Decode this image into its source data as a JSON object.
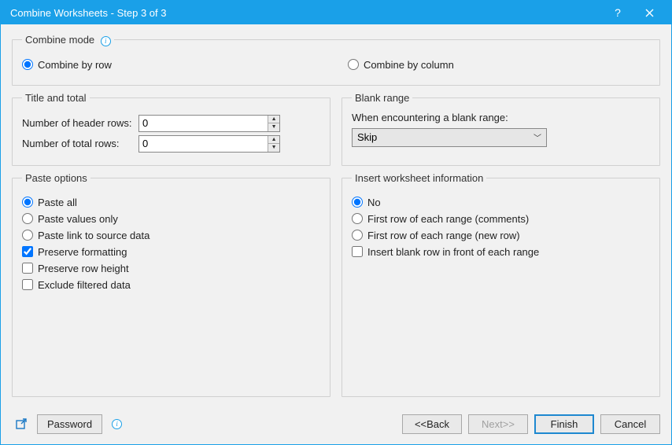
{
  "title": "Combine Worksheets - Step 3 of 3",
  "combineMode": {
    "legend": "Combine mode",
    "byRow": "Combine by row",
    "byColumn": "Combine by column"
  },
  "titleTotal": {
    "legend": "Title and total",
    "headerLabel": "Number of header rows:",
    "headerValue": "0",
    "totalLabel": "Number of total rows:",
    "totalValue": "0"
  },
  "blankRange": {
    "legend": "Blank range",
    "prompt": "When encountering a blank range:",
    "selected": "Skip"
  },
  "pasteOptions": {
    "legend": "Paste options",
    "pasteAll": "Paste all",
    "valuesOnly": "Paste values only",
    "linkSource": "Paste link to source data",
    "preserveFormatting": "Preserve formatting",
    "preserveRowHeight": "Preserve row height",
    "excludeFiltered": "Exclude filtered data"
  },
  "insertInfo": {
    "legend": "Insert worksheet information",
    "no": "No",
    "firstRowComments": "First row of each range (comments)",
    "firstRowNew": "First row of each range (new row)",
    "insertBlank": "Insert blank row in front of each range"
  },
  "buttons": {
    "password": "Password",
    "back": "<<Back",
    "next": "Next>>",
    "finish": "Finish",
    "cancel": "Cancel"
  }
}
